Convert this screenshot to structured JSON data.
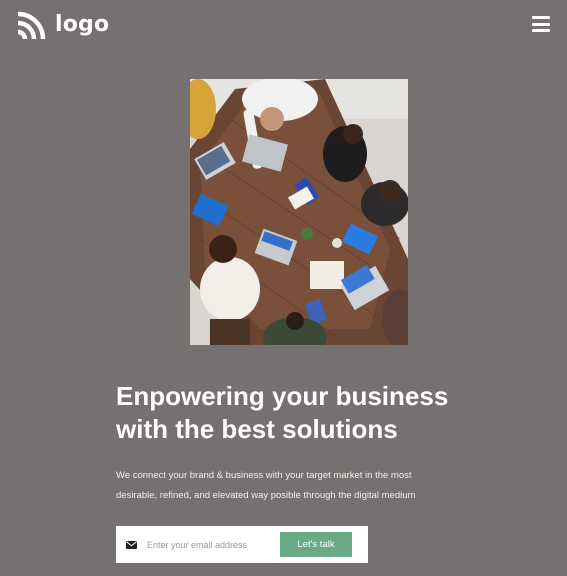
{
  "brand": {
    "logo_text": "logo",
    "logo_icon": "rss-arcs-icon"
  },
  "header": {
    "menu_icon": "hamburger-menu-icon"
  },
  "hero": {
    "image_icon": "team-meeting-photo",
    "headline": "Enpowering your business with the best solutions",
    "subtext": "We connect your brand & business with your target market in the most desirable, refined, and elevated way posible through the digital medium"
  },
  "signup": {
    "email_icon": "envelope-icon",
    "email_placeholder": "Enter your email address",
    "email_value": "",
    "button_label": "Let's talk"
  },
  "colors": {
    "background": "#757170",
    "accent": "#6aab85",
    "text": "#ffffff"
  }
}
